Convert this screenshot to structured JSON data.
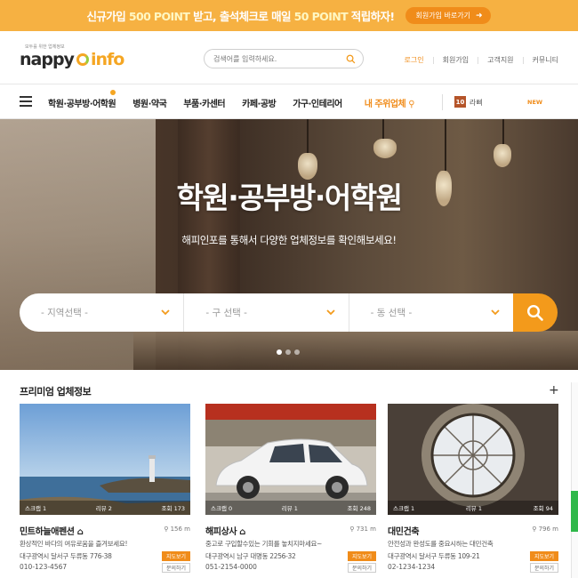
{
  "promo": {
    "part1": "신규가입",
    "point1": "500 POINT",
    "part2": "받고, 출석체크로 매일",
    "point2": "50 POINT",
    "part3": "적립하자!",
    "button": "회원가입 바로가기"
  },
  "header": {
    "logo_tagline": "모두를 위한 업체정보",
    "logo_word1": "nappy",
    "logo_word2": "info",
    "search_placeholder": "검색어를 입력하세요.",
    "links": [
      "로그인",
      "회원가입",
      "고객지원",
      "커뮤니티"
    ]
  },
  "nav": {
    "items": [
      "학원·공부방·어학원",
      "병원·약국",
      "부품·카센터",
      "카페·공방",
      "가구·인테리어"
    ],
    "nearby": "내 주위업체",
    "badge_count": "10",
    "badge_label": "라삐",
    "new_label": "NEW"
  },
  "hero": {
    "title": "학원·공부방·어학원",
    "subtitle": "해피인포를 통해서 다양한 업체정보를 확인해보세요!",
    "filters": [
      "- 지역선택 -",
      "- 구 선택 -",
      "- 동 선택 -"
    ],
    "slide_count": 3,
    "active_slide": 0
  },
  "premium": {
    "title": "프리미엄 업체정보",
    "cards": [
      {
        "scrap": "스크랩 1",
        "review": "리뷰 2",
        "views": "조회 173",
        "name": "민트하늘애펜션",
        "distance": "156 m",
        "desc": "환상적인 바다의 여유로움을 즐겨보세요!",
        "addr": "대구광역시 달서구 두류동 776-38",
        "tel": "010-123-4567",
        "map_btn": "지도보기",
        "ask_btn": "문의하기"
      },
      {
        "scrap": "스크랩 0",
        "review": "리뷰 1",
        "views": "조회 248",
        "name": "해피상사",
        "distance": "731 m",
        "desc": "중고로 구입할수있는 기회를 놓치지마세요~",
        "addr": "대구광역시 남구 대명동 2256-32",
        "tel": "051-2154-0000",
        "map_btn": "지도보기",
        "ask_btn": "문의하기"
      },
      {
        "scrap": "스크랩 1",
        "review": "리뷰 1",
        "views": "조회 94",
        "name": "대민건축",
        "distance": "796 m",
        "desc": "안전성과 완성도를 중요시하는 대민건축",
        "addr": "대구광역시 달서구 두류동 109-21",
        "tel": "02-1234-1234",
        "map_btn": "지도보기",
        "ask_btn": "문의하기"
      }
    ]
  },
  "colors": {
    "promo_bg": "#f6b142",
    "accent": "#f08c1a",
    "search_button": "#f39a1b",
    "badge": "#b5552a"
  }
}
